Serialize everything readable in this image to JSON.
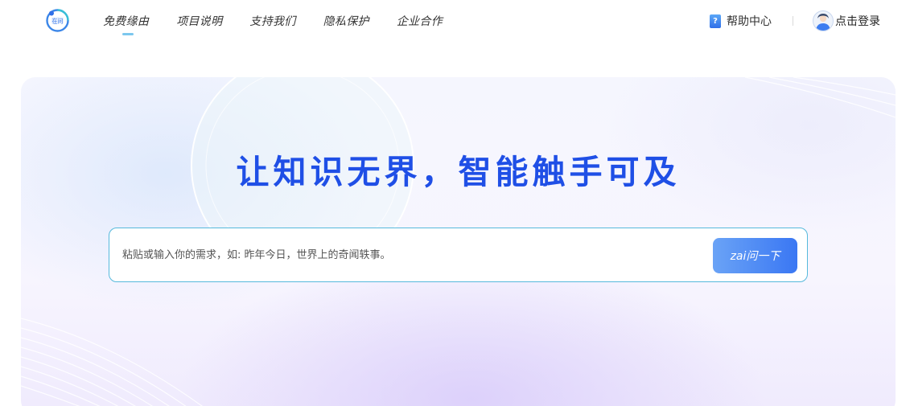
{
  "header": {
    "logo_icon": "zaiwen-logo-icon",
    "nav": [
      {
        "label": "免费缘由",
        "active": true
      },
      {
        "label": "项目说明",
        "active": false
      },
      {
        "label": "支持我们",
        "active": false
      },
      {
        "label": "隐私保护",
        "active": false
      },
      {
        "label": "企业合作",
        "active": false
      }
    ],
    "help": {
      "icon": "help-book-icon",
      "label": "帮助中心"
    },
    "login": {
      "icon": "user-avatar-icon",
      "label": "点击登录"
    }
  },
  "hero": {
    "headline": "让知识无界，智能触手可及",
    "search": {
      "placeholder": "粘贴或输入你的需求，如: 昨年今日，世界上的奇闻轶事。",
      "value": "",
      "button_label": "zai问一下"
    }
  },
  "colors": {
    "headline": "#1f4fe6",
    "search_border": "#56b9dc",
    "button_start": "#6aa3f6",
    "button_end": "#3a77f3",
    "nav_active_underline": "#7cc7ee"
  }
}
